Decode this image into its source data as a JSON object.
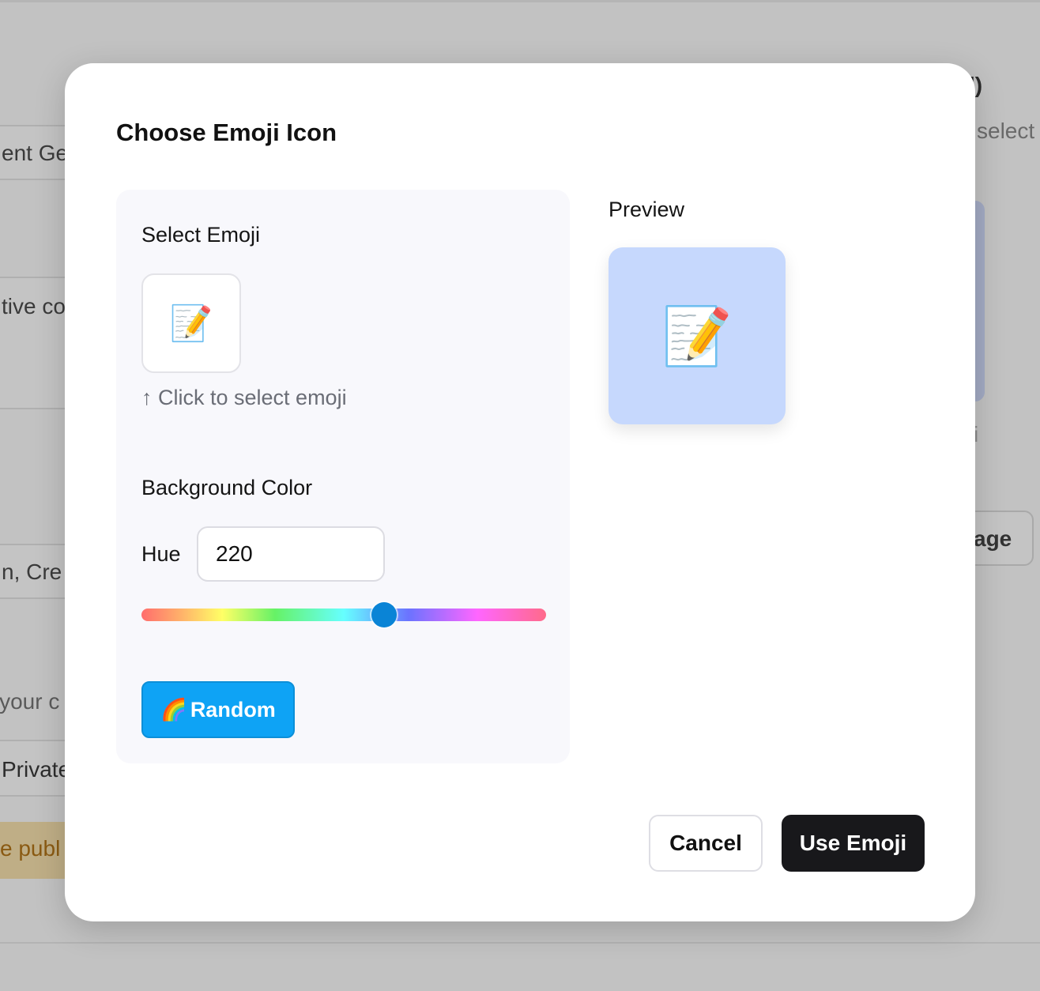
{
  "background": {
    "fragments": [
      "ent Ge",
      "tive co",
      "n, Cre",
      "r your c",
      "Private",
      "e publ",
      "l)",
      "select",
      "age",
      "i"
    ]
  },
  "modal": {
    "title": "Choose Emoji Icon",
    "select_emoji": {
      "label": "Select Emoji",
      "selected_emoji": "📝",
      "hint": "↑ Click to select emoji"
    },
    "background_color": {
      "label": "Background Color",
      "hue_label": "Hue",
      "hue_value": "220",
      "hue_fraction": 0.6,
      "preview_color": "#c6d8fd"
    },
    "random_button": {
      "icon": "🌈",
      "label": "Random"
    },
    "preview": {
      "label": "Preview",
      "emoji": "📝"
    },
    "actions": {
      "cancel": "Cancel",
      "confirm": "Use Emoji"
    }
  }
}
